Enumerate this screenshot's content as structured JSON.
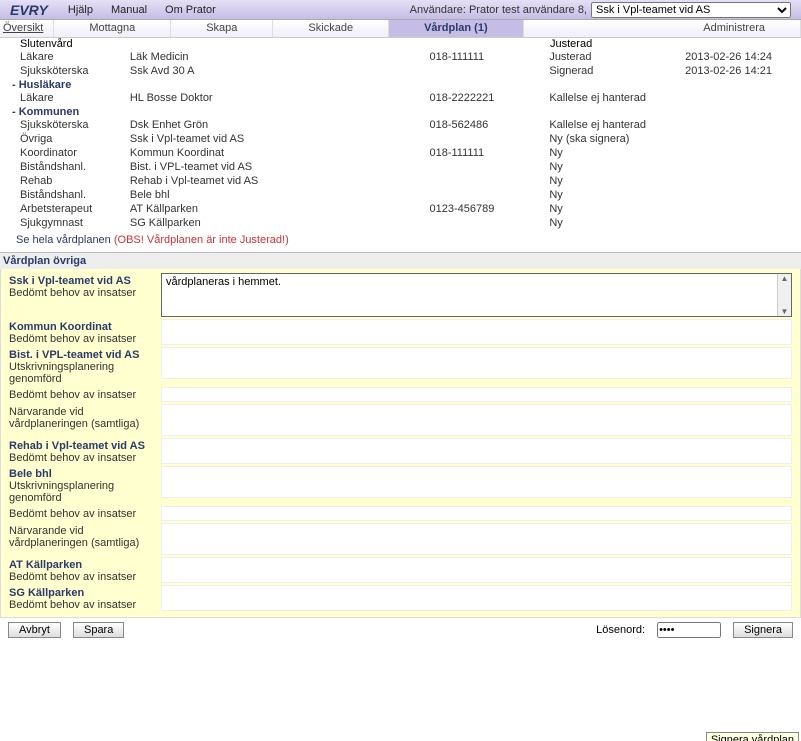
{
  "topbar": {
    "logo": "EVRY",
    "menus": [
      "Hjälp",
      "Manual",
      "Om Prator"
    ],
    "user_label": "Användare: Prator test användare 8,",
    "dropdown_selected": "Ssk i Vpl-teamet vid AS"
  },
  "tabs": {
    "items": [
      "Översikt",
      "Mottagna",
      "Skapa",
      "Skickade",
      "Vårdplan (1)",
      "Administrera"
    ],
    "active_index": 4
  },
  "care": {
    "partial": {
      "c1": "Slutenvård",
      "c4": "Justerad"
    },
    "groups": [
      {
        "head": null,
        "rows": [
          {
            "c1": "Läkare",
            "c2": "Läk Medicin",
            "c3": "018-111111",
            "c4": "Justerad",
            "c5": "2013-02-26 14:24"
          },
          {
            "c1": "Sjuksköterska",
            "c2": "Ssk Avd 30 A",
            "c3": "",
            "c4": "Signerad",
            "c5": "2013-02-26 14:21"
          }
        ]
      },
      {
        "head": "Husläkare",
        "rows": [
          {
            "c1": "Läkare",
            "c2": "HL Bosse Doktor",
            "c3": "018-2222221",
            "c4": "Kallelse ej hanterad",
            "c5": ""
          }
        ]
      },
      {
        "head": "Kommunen",
        "rows": [
          {
            "c1": "Sjuksköterska",
            "c2": "Dsk Enhet Grön",
            "c3": "018-562486",
            "c4": "Kallelse ej hanterad",
            "c5": ""
          },
          {
            "c1": "Övriga",
            "c2": "Ssk i Vpl-teamet vid AS",
            "c3": "",
            "c4": "Ny (ska signera)",
            "c5": ""
          },
          {
            "c1": "Koordinator",
            "c2": "Kommun Koordinat",
            "c3": "018-111111",
            "c4": "Ny",
            "c5": ""
          },
          {
            "c1": "Biståndshanl.",
            "c2": "Bist. i VPL-teamet vid AS",
            "c3": "",
            "c4": "Ny",
            "c5": ""
          },
          {
            "c1": "Rehab",
            "c2": "Rehab i Vpl-teamet vid AS",
            "c3": "",
            "c4": "Ny",
            "c5": ""
          },
          {
            "c1": "Biståndshanl.",
            "c2": "Bele bhl",
            "c3": "",
            "c4": "Ny",
            "c5": ""
          },
          {
            "c1": "Arbetsterapeut",
            "c2": "AT Källparken",
            "c3": "0123-456789",
            "c4": "Ny",
            "c5": ""
          },
          {
            "c1": "Sjukgymnast",
            "c2": "SG Källparken",
            "c3": "",
            "c4": "Ny",
            "c5": ""
          }
        ]
      }
    ],
    "link_text": "Se hela vårdplanen ",
    "link_warn": "(OBS! Vårdplanen är inte Justerad!)"
  },
  "section_title": "Vårdplan övriga",
  "blocks": [
    {
      "head": "Ssk i Vpl-teamet vid AS",
      "sub": "Bedömt behov av insatser",
      "textbox": true,
      "value": "vårdplaneras i hemmet."
    },
    {
      "head": "Kommun Koordinat",
      "sub": "Bedömt behov av insatser"
    },
    {
      "head": "Bist. i VPL-teamet vid AS",
      "sub": "Utskrivningsplanering genomförd",
      "tall": true
    },
    {
      "sub": "Bedömt behov av insatser"
    },
    {
      "sub": "Närvarande vid vårdplaneringen (samtliga)",
      "tall": true
    },
    {
      "head": "Rehab i Vpl-teamet vid AS",
      "sub": "Bedömt behov av insatser"
    },
    {
      "head": "Bele bhl",
      "sub": "Utskrivningsplanering genomförd",
      "tall": true
    },
    {
      "sub": "Bedömt behov av insatser"
    },
    {
      "sub": "Närvarande vid vårdplaneringen (samtliga)",
      "tall": true
    },
    {
      "head": "AT Källparken",
      "sub": "Bedömt behov av insatser"
    },
    {
      "head": "SG Källparken",
      "sub": "Bedömt behov av insatser"
    }
  ],
  "footer": {
    "cancel": "Avbryt",
    "save": "Spara",
    "pw_label": "Lösenord:",
    "pw_value": "••••",
    "sign": "Signera"
  },
  "tooltip": "Signera vårdplan"
}
